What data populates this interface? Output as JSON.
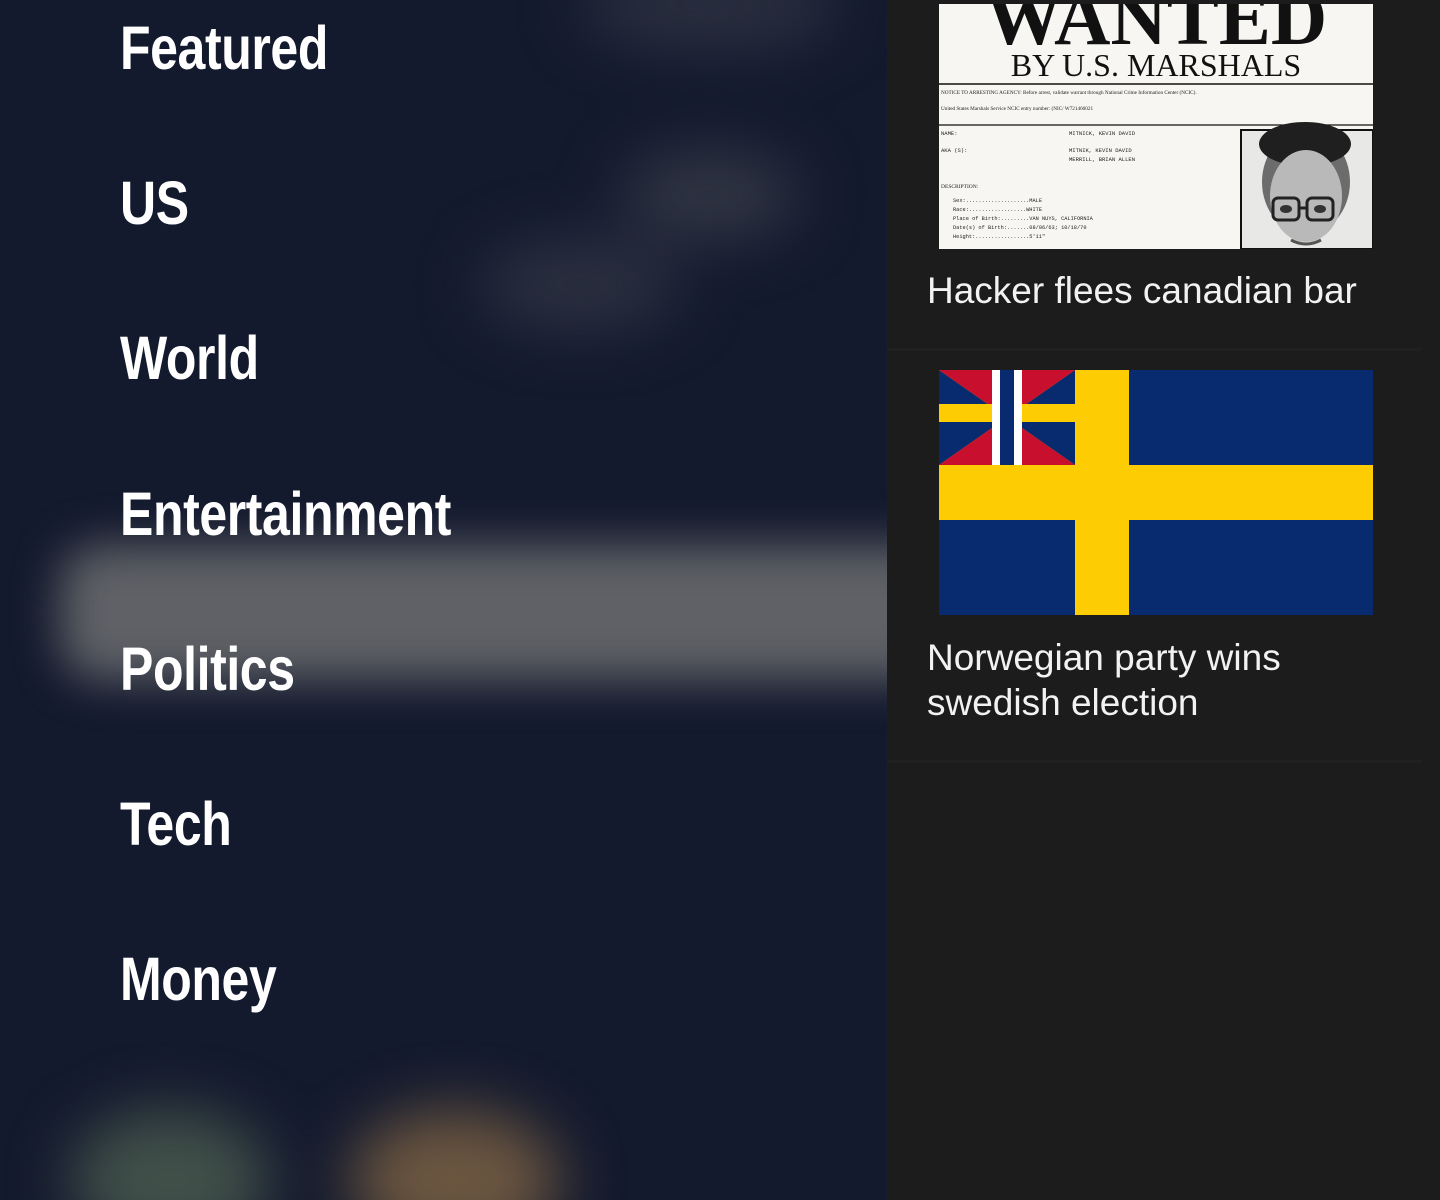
{
  "categories": [
    "Featured",
    "US",
    "World",
    "Entertainment",
    "Politics",
    "Tech",
    "Money"
  ],
  "articles": [
    {
      "title": "Hacker flees canadian bar",
      "image": {
        "type": "wanted-poster",
        "headline": "WANTED",
        "subheadline": "BY U.S. MARSHALS",
        "notice": "NOTICE TO ARRESTING AGENCY:  Before arrest, validate warrant through National Crime Information Center (NCIC).",
        "ncic": "United States Marshals Service NCIC entry number:  (NIC/  W721460021",
        "name_label": "NAME:",
        "name_value": "MITNICK, KEVIN DAVID",
        "aka_label": "AKA (S):",
        "aka_value_1": "MITNIK, KEVIN DAVID",
        "aka_value_2": "MERRILL, BRIAN ALLEN",
        "description_label": "DESCRIPTION:",
        "sex": "Sex:....................MALE",
        "race": "Race:..................WHITE",
        "pob": "Place of Birth:.........VAN NUYS, CALIFORNIA",
        "dob": "Date(s) of Birth:.......08/06/63; 10/18/70",
        "height": "Height:.................5'11\""
      }
    },
    {
      "title": "Norwegian party wins swedish election",
      "image": {
        "type": "union-flag",
        "colors": {
          "blue": "#082a6e",
          "yellow": "#fecc02",
          "red": "#c8102e",
          "white": "#ffffff"
        }
      }
    }
  ]
}
